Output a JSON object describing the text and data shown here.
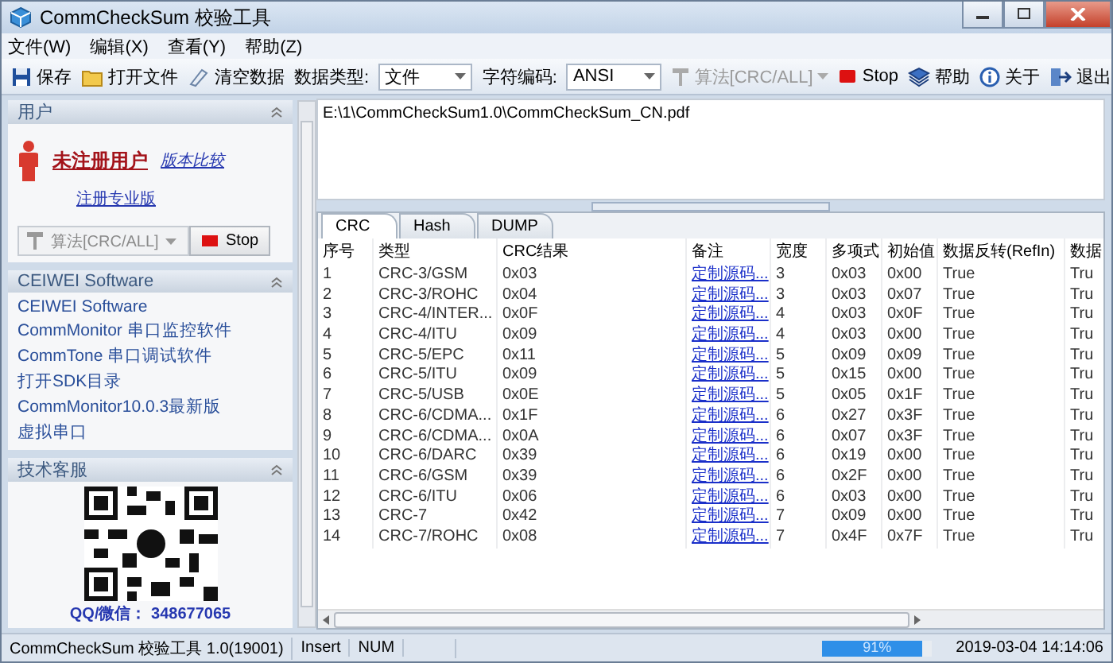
{
  "window": {
    "title": "CommCheckSum 校验工具"
  },
  "menu": [
    "文件(W)",
    "编辑(X)",
    "查看(Y)",
    "帮助(Z)"
  ],
  "toolbar": [
    {
      "kind": "button",
      "label": "保存",
      "disabled": false
    },
    {
      "kind": "button",
      "label": "打开文件",
      "disabled": false
    },
    {
      "kind": "button",
      "label": "清空数据",
      "disabled": false
    },
    {
      "kind": "combo",
      "label": "数据类型:",
      "value": "文件"
    },
    {
      "kind": "combo",
      "label": "字符编码:",
      "value": "ANSI"
    },
    {
      "kind": "dropdown",
      "label": "算法[CRC/ALL]",
      "disabled": true
    },
    {
      "kind": "button",
      "label": "Stop",
      "disabled": false
    },
    {
      "kind": "button",
      "label": "帮助",
      "disabled": false
    },
    {
      "kind": "button",
      "label": "关于",
      "disabled": false
    },
    {
      "kind": "button",
      "label": "退出",
      "disabled": false
    }
  ],
  "sidebar": {
    "user_panel": {
      "title": "用户",
      "user": "未注册用户",
      "compare_link": "版本比较",
      "register_link": "注册专业版",
      "algorithm": "算法[CRC/ALL]",
      "stop": "Stop"
    },
    "software_panel": {
      "title": "CEIWEI Software",
      "links": [
        "CEIWEI Software",
        "CommMonitor 串口监控软件",
        "CommTone 串口调试软件",
        "打开SDK目录",
        "CommMonitor10.0.3最新版",
        "虚拟串口"
      ]
    },
    "support_panel": {
      "title": "技术客服",
      "contact": "QQ/微信： 348677065"
    }
  },
  "file_path": "E:\\1\\CommCheckSum1.0\\CommCheckSum_CN.pdf",
  "tabs": [
    {
      "label": "CRC",
      "selected": true
    },
    {
      "label": "Hash",
      "selected": false
    },
    {
      "label": "DUMP",
      "selected": false
    }
  ],
  "table": {
    "columns": [
      {
        "label": "序号",
        "kind": "text"
      },
      {
        "label": "类型",
        "kind": "text"
      },
      {
        "label": "CRC结果",
        "kind": "text"
      },
      {
        "label": "备注",
        "kind": "link"
      },
      {
        "label": "宽度",
        "kind": "text"
      },
      {
        "label": "多项式",
        "kind": "text"
      },
      {
        "label": "初始值",
        "kind": "text"
      },
      {
        "label": "数据反转(RefIn)",
        "kind": "text"
      },
      {
        "label": "数据",
        "kind": "text"
      }
    ],
    "rows": [
      [
        "1",
        "CRC-3/GSM",
        "0x03",
        "定制源码...",
        "3",
        "0x03",
        "0x00",
        "True",
        "Tru"
      ],
      [
        "2",
        "CRC-3/ROHC",
        "0x04",
        "定制源码...",
        "3",
        "0x03",
        "0x07",
        "True",
        "Tru"
      ],
      [
        "3",
        "CRC-4/INTER...",
        "0x0F",
        "定制源码...",
        "4",
        "0x03",
        "0x0F",
        "True",
        "Tru"
      ],
      [
        "4",
        "CRC-4/ITU",
        "0x09",
        "定制源码...",
        "4",
        "0x03",
        "0x00",
        "True",
        "Tru"
      ],
      [
        "5",
        "CRC-5/EPC",
        "0x11",
        "定制源码...",
        "5",
        "0x09",
        "0x09",
        "True",
        "Tru"
      ],
      [
        "6",
        "CRC-5/ITU",
        "0x09",
        "定制源码...",
        "5",
        "0x15",
        "0x00",
        "True",
        "Tru"
      ],
      [
        "7",
        "CRC-5/USB",
        "0x0E",
        "定制源码...",
        "5",
        "0x05",
        "0x1F",
        "True",
        "Tru"
      ],
      [
        "8",
        "CRC-6/CDMA...",
        "0x1F",
        "定制源码...",
        "6",
        "0x27",
        "0x3F",
        "True",
        "Tru"
      ],
      [
        "9",
        "CRC-6/CDMA...",
        "0x0A",
        "定制源码...",
        "6",
        "0x07",
        "0x3F",
        "True",
        "Tru"
      ],
      [
        "10",
        "CRC-6/DARC",
        "0x39",
        "定制源码...",
        "6",
        "0x19",
        "0x00",
        "True",
        "Tru"
      ],
      [
        "11",
        "CRC-6/GSM",
        "0x39",
        "定制源码...",
        "6",
        "0x2F",
        "0x00",
        "True",
        "Tru"
      ],
      [
        "12",
        "CRC-6/ITU",
        "0x06",
        "定制源码...",
        "6",
        "0x03",
        "0x00",
        "True",
        "Tru"
      ],
      [
        "13",
        "CRC-7",
        "0x42",
        "定制源码...",
        "7",
        "0x09",
        "0x00",
        "True",
        "Tru"
      ],
      [
        "14",
        "CRC-7/ROHC",
        "0x08",
        "定制源码...",
        "7",
        "0x4F",
        "0x7F",
        "True",
        "Tru"
      ]
    ]
  },
  "status_bar": {
    "app": "CommCheckSum 校验工具 1.0(19001)",
    "mode": "Insert",
    "num": "NUM",
    "progress": {
      "level": 0.91,
      "text": "91%"
    },
    "time": "2019-03-04 14:14:06"
  }
}
